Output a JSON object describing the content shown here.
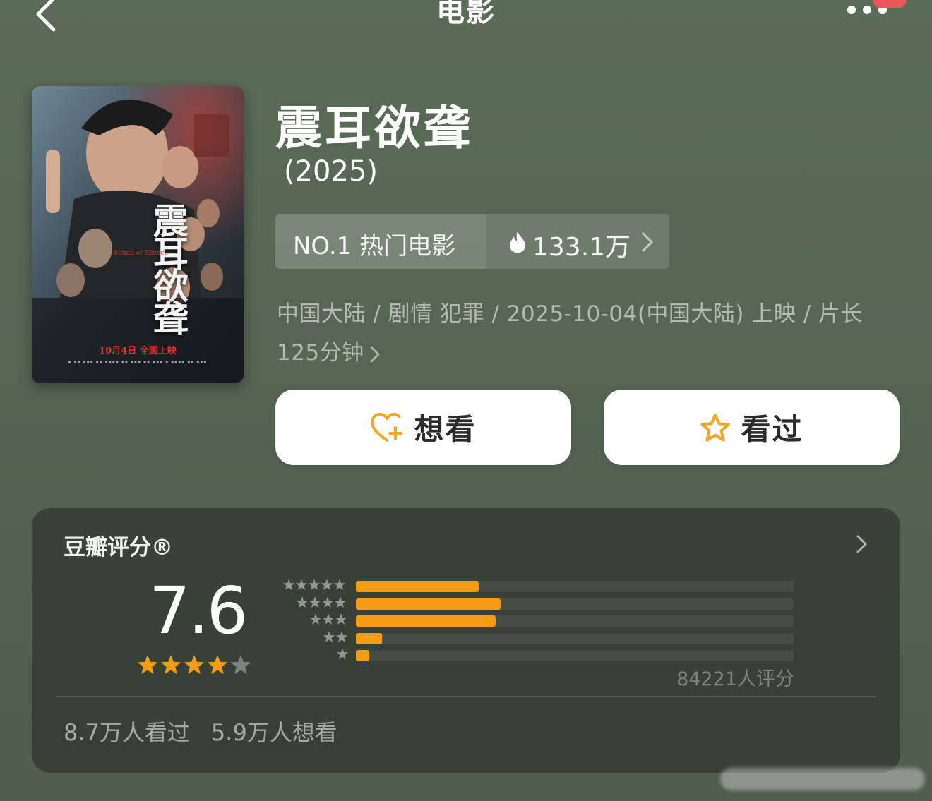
{
  "header": {
    "title": "电影",
    "back_icon": "chevron-left-icon",
    "more_icon": "more-dots-icon"
  },
  "movie": {
    "title": "震耳欲聋",
    "year": "(2025)",
    "poster": {
      "title_cn": "震耳欲聋",
      "title_en": "Sound of Silence",
      "release_note": "10月4日 全国上映"
    },
    "rank_label": "NO.1 热门电影",
    "heat_value": "133.1万",
    "meta": "中国大陆 / 剧情 犯罪 / 2025-10-04(中国大陆) 上映 / 片长 125分钟"
  },
  "actions": {
    "want_label": "想看",
    "want_icon": "heart-plus-icon",
    "seen_label": "看过",
    "seen_icon": "star-outline-icon",
    "icon_color": "#f5a623"
  },
  "rating": {
    "brand": "豆瓣评分®",
    "score": "7.6",
    "star_rating": 4,
    "star_max": 5,
    "distribution": [
      {
        "stars": 5,
        "share": 0.28
      },
      {
        "stars": 4,
        "share": 0.33
      },
      {
        "stars": 3,
        "share": 0.32
      },
      {
        "stars": 2,
        "share": 0.06
      },
      {
        "stars": 1,
        "share": 0.03
      }
    ],
    "vote_count": "84221人评分",
    "seen_count": "8.7万人看过",
    "want_count": "5.9万人想看",
    "accent_color": "#f59b14"
  }
}
